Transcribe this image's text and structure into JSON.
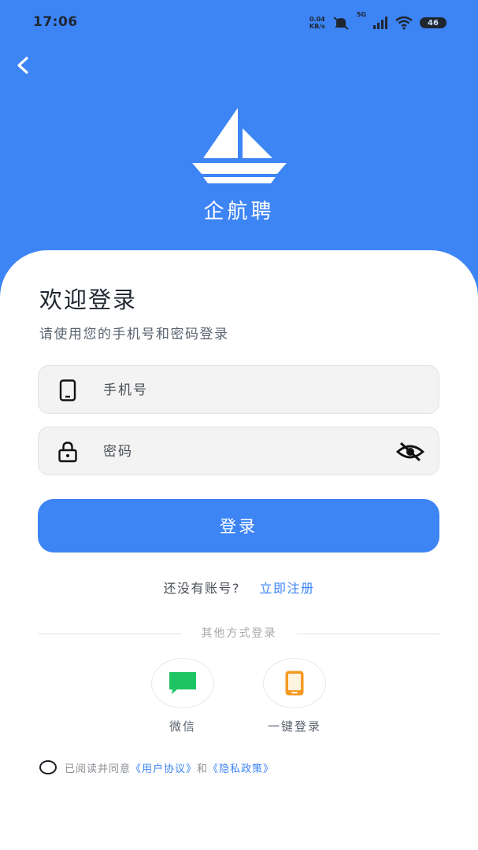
{
  "status": {
    "time": "17:06",
    "net_speed_value": "0.04",
    "net_speed_unit": "KB/s",
    "network_type": "5G",
    "battery": "46"
  },
  "brand": {
    "name": "企航聘"
  },
  "welcome": {
    "title": "欢迎登录",
    "subtitle": "请使用您的手机号和密码登录"
  },
  "form": {
    "phone_placeholder": "手机号",
    "password_placeholder": "密码",
    "login_label": "登录"
  },
  "register": {
    "question": "还没有账号?",
    "link": "立即注册"
  },
  "other_login": {
    "title": "其他方式登录",
    "wechat_label": "微信",
    "onekey_label": "一键登录"
  },
  "agreement": {
    "prefix": "已阅读并同意",
    "user_agreement": "《用户协议》",
    "and": "和",
    "privacy_policy": "《隐私政策》"
  },
  "colors": {
    "primary": "#3d84f5",
    "wechat_green": "#1fc462",
    "onekey_orange": "#f59a23"
  }
}
